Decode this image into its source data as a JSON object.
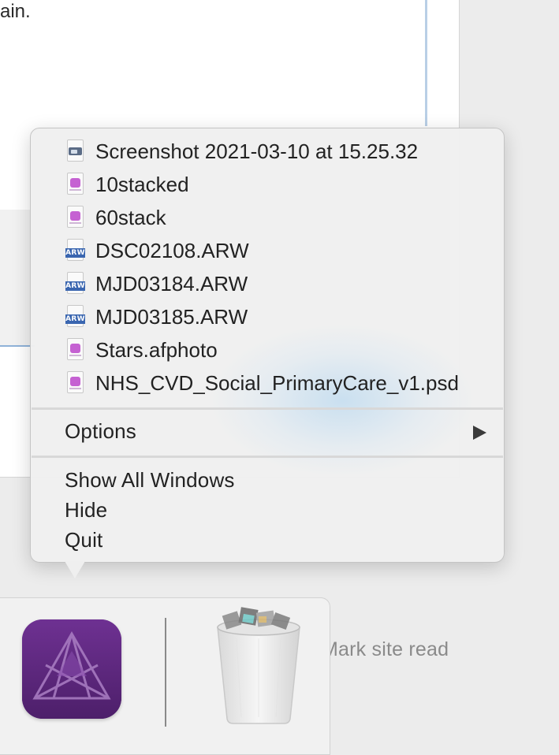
{
  "background": {
    "page_text_fragment": "ain.",
    "dock_hint_text": "Mark site read"
  },
  "menu": {
    "recent_files": [
      {
        "label": "Screenshot 2021-03-10 at 15.25.32",
        "icon": "screenshot-file-icon"
      },
      {
        "label": "10stacked",
        "icon": "afphoto-file-icon"
      },
      {
        "label": "60stack",
        "icon": "afphoto-file-icon"
      },
      {
        "label": "DSC02108.ARW",
        "icon": "arw-file-icon"
      },
      {
        "label": "MJD03184.ARW",
        "icon": "arw-file-icon"
      },
      {
        "label": "MJD03185.ARW",
        "icon": "arw-file-icon"
      },
      {
        "label": "Stars.afphoto",
        "icon": "afphoto-file-icon"
      },
      {
        "label": "NHS_CVD_Social_PrimaryCare_v1.psd",
        "icon": "afphoto-file-icon"
      }
    ],
    "arw_badge": "ARW",
    "options_label": "Options",
    "actions": {
      "show_all_windows": "Show All Windows",
      "hide": "Hide",
      "quit": "Quit"
    }
  },
  "dock": {
    "apps": [
      {
        "name": "affinity-photo-icon"
      },
      {
        "name": "trash-icon"
      }
    ]
  },
  "colors": {
    "menu_background": "#efefef",
    "afphoto_badge": "#c561d2",
    "arw_band": "#3a66b0",
    "affinity_photo_purple": "#5a2576"
  }
}
